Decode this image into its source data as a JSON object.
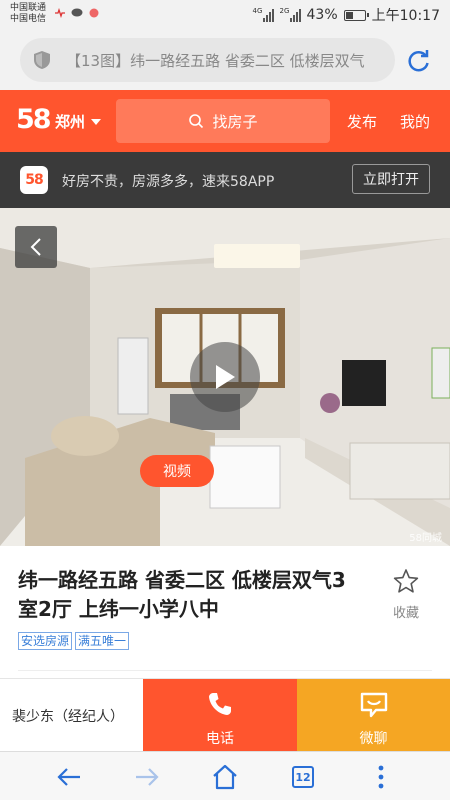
{
  "status_bar": {
    "carrier_1": "中国联通",
    "carrier_2": "中国电信",
    "battery": "43%",
    "time": "上午10:17",
    "network_1": "4G",
    "network_2": "2G",
    "battery_level": 0.43
  },
  "browser": {
    "url_text": "【13图】纬一路经五路 省委二区 低楼层双气",
    "open_tabs": "12"
  },
  "header": {
    "logo": "58",
    "city": "郑州",
    "search_label": "找房子",
    "post_label": "发布",
    "mine_label": "我的",
    "accent_color": "#ff552e"
  },
  "app_banner": {
    "icon_text": "58",
    "text": "好房不贵，房源多多，速来58APP",
    "open_label": "立即打开"
  },
  "photo": {
    "video_label": "视频",
    "watermark": "58同城"
  },
  "listing": {
    "title": "纬一路经五路 省委二区 低楼层双气3室2厅 上纬一小学八中",
    "favorite_label": "收藏",
    "tags": [
      "安选房源",
      "满五唯一"
    ]
  },
  "contact": {
    "agent": "裴少东（经纪人）",
    "call_label": "电话",
    "chat_label": "微聊"
  }
}
